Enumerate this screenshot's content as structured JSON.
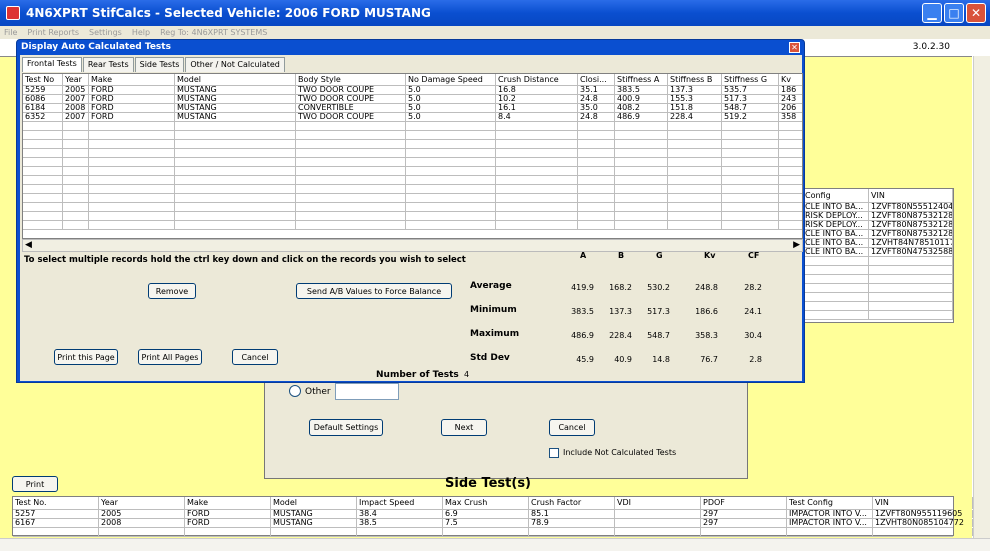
{
  "app": {
    "title": "4N6XPRT StifCalcs - Selected Vehicle: 2006 FORD MUSTANG",
    "version": "3.0.2.30"
  },
  "menu": [
    "File",
    "Print Reports",
    "Settings",
    "Help",
    "Reg To: 4N6XPRT SYSTEMS"
  ],
  "popup": {
    "title": "Display Auto Calculated Tests",
    "tabs": [
      "Frontal Tests",
      "Rear Tests",
      "Side Tests",
      "Other / Not Calculated"
    ],
    "columns": [
      "Test No",
      "Year",
      "Make",
      "Model",
      "Body Style",
      "No Damage Speed",
      "Crush Distance",
      "Closi...",
      "Stiffness A",
      "Stiffness B",
      "Stiffness G",
      "Kv"
    ],
    "rows": [
      [
        "5259",
        "2005",
        "FORD",
        "MUSTANG",
        "TWO DOOR COUPE",
        "5.0",
        "16.8",
        "35.1",
        "383.5",
        "137.3",
        "535.7",
        "186"
      ],
      [
        "6086",
        "2007",
        "FORD",
        "MUSTANG",
        "TWO DOOR COUPE",
        "5.0",
        "10.2",
        "24.8",
        "400.9",
        "155.3",
        "517.3",
        "243"
      ],
      [
        "6184",
        "2008",
        "FORD",
        "MUSTANG",
        "CONVERTIBLE",
        "5.0",
        "16.1",
        "35.0",
        "408.2",
        "151.8",
        "548.7",
        "206"
      ],
      [
        "6352",
        "2007",
        "FORD",
        "MUSTANG",
        "TWO DOOR COUPE",
        "5.0",
        "8.4",
        "24.8",
        "486.9",
        "228.4",
        "519.2",
        "358"
      ]
    ],
    "instructions": "To select multiple records hold the ctrl key down and click on the records you wish to select",
    "buttons": {
      "remove": "Remove",
      "send": "Send A/B Values to Force Balance",
      "print_page": "Print this Page",
      "print_all": "Print All Pages",
      "cancel": "Cancel"
    },
    "stats": {
      "headers": [
        "A",
        "B",
        "G",
        "Kv",
        "CF"
      ],
      "labels": [
        "Average",
        "Minimum",
        "Maximum",
        "Std Dev"
      ],
      "values": [
        [
          "419.9",
          "168.2",
          "530.2",
          "248.8",
          "28.2"
        ],
        [
          "383.5",
          "137.3",
          "517.3",
          "186.6",
          "24.1"
        ],
        [
          "486.9",
          "228.4",
          "548.7",
          "358.3",
          "30.4"
        ],
        [
          "45.9",
          "40.9",
          "14.8",
          "76.7",
          "2.8"
        ]
      ],
      "num_tests_label": "Number of Tests",
      "num_tests": "4"
    }
  },
  "right_list": {
    "columns": [
      "Config",
      "VIN"
    ],
    "rows": [
      [
        "CLE INTO BA...",
        "1ZVFT80N555124042"
      ],
      [
        "RISK DEPLOY...",
        "1ZVFT80N875321287"
      ],
      [
        "RISK DEPLOY...",
        "1ZVFT80N875321287"
      ],
      [
        "CLE INTO BA...",
        "1ZVFT80N875321287"
      ],
      [
        "CLE INTO BA...",
        "1ZVHT84N785101174"
      ],
      [
        "CLE INTO BA...",
        "1ZVFT80N475325885"
      ]
    ]
  },
  "dialog": {
    "other_label": "Other",
    "other_value": "",
    "default_settings": "Default Settings",
    "next": "Next",
    "cancel": "Cancel",
    "include_label": "Include Not Calculated Tests"
  },
  "print_button": "Print",
  "side": {
    "title": "Side Test(s)",
    "columns": [
      "Test No.",
      "Year",
      "Make",
      "Model",
      "Impact Speed",
      "Max Crush",
      "Crush Factor",
      "VDI",
      "PDOF",
      "Test Config",
      "VIN"
    ],
    "rows": [
      [
        "5257",
        "2005",
        "FORD",
        "MUSTANG",
        "38.4",
        "6.9",
        "85.1",
        "",
        "297",
        "IMPACTOR INTO V...",
        "1ZVFT80N955119605"
      ],
      [
        "6167",
        "2008",
        "FORD",
        "MUSTANG",
        "38.5",
        "7.5",
        "78.9",
        "",
        "297",
        "IMPACTOR INTO V...",
        "1ZVHT80N085104772"
      ]
    ]
  }
}
